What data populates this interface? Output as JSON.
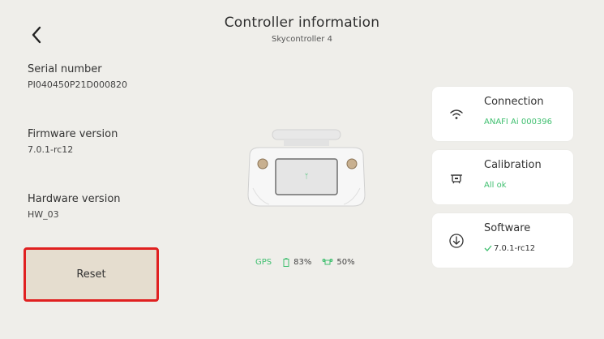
{
  "header": {
    "title": "Controller information",
    "subtitle": "Skycontroller 4"
  },
  "info": {
    "serial_label": "Serial number",
    "serial_value": "PI040450P21D000820",
    "firmware_label": "Firmware version",
    "firmware_value": "7.0.1-rc12",
    "hardware_label": "Hardware version",
    "hardware_value": "HW_03"
  },
  "reset_label": "Reset",
  "stats": {
    "gps": "GPS",
    "controller_battery": "83%",
    "drone_battery": "50%"
  },
  "cards": {
    "connection": {
      "title": "Connection",
      "value": "ANAFI Ai 000396",
      "icon": "wifi-icon"
    },
    "calibration": {
      "title": "Calibration",
      "value": "All ok",
      "icon": "drone-icon"
    },
    "software": {
      "title": "Software",
      "value": "7.0.1-rc12",
      "icon": "download-icon"
    }
  },
  "colors": {
    "background": "#efeeea",
    "accent_green": "#3fbf6f",
    "highlight_red": "#e02020",
    "reset_button": "#e5ddcf"
  }
}
